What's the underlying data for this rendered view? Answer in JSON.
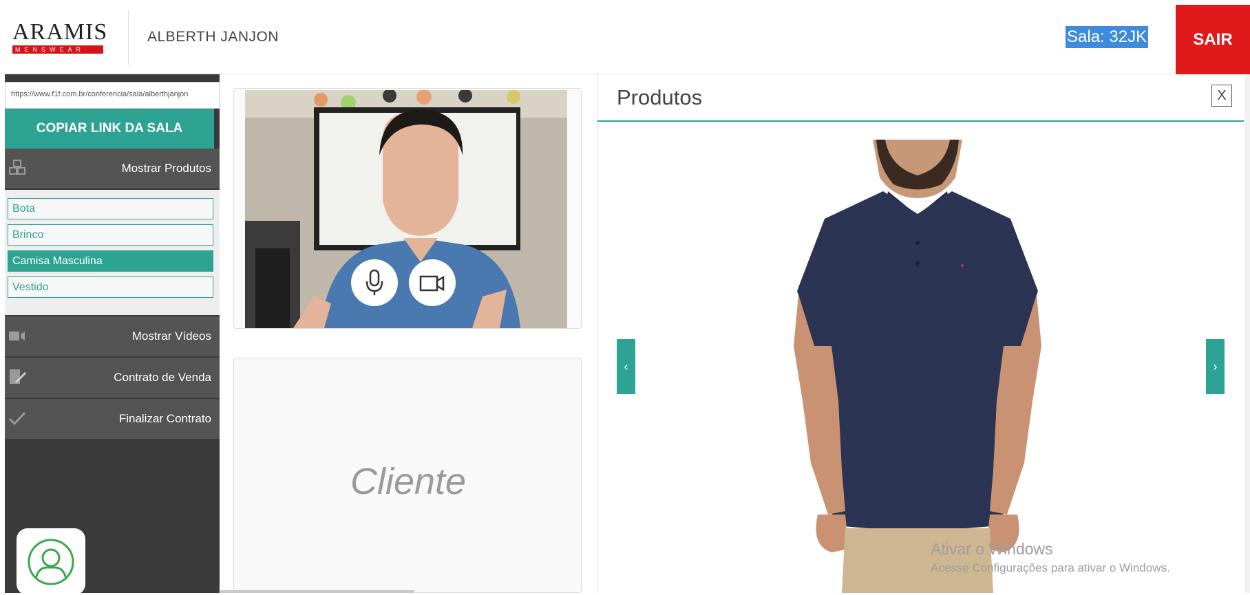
{
  "header": {
    "logo_word": "ARAMIS",
    "logo_sub": "MENSWEAR",
    "username": "ALBERTH JANJON",
    "room_label": "Sala: 32JK",
    "exit_label": "SAIR"
  },
  "sidebar": {
    "room_url": "https://www.f1f.com.br/conferencia/sala/alberthjanjon",
    "copy_link_label": "COPIAR LINK DA SALA",
    "show_products_label": "Mostrar Produtos",
    "products": [
      "Bota",
      "Brinco",
      "Camisa Masculina",
      "Vestido"
    ],
    "selected_product": "Camisa Masculina",
    "show_videos_label": "Mostrar Vídeos",
    "contract_label": "Contrato de Venda",
    "finish_label": "Finalizar Contrato"
  },
  "main": {
    "client_label": "Cliente"
  },
  "panel": {
    "title": "Produtos",
    "close_label": "X",
    "prev_label": "‹",
    "next_label": "›"
  },
  "watermark": {
    "line1": "Ativar o Windows",
    "line2": "Acesse Configurações para ativar o Windows."
  },
  "colors": {
    "accent": "#2da394",
    "exit": "#e01a1a",
    "sidebar_bg": "#3a3a3a",
    "menu_bg": "#545454",
    "shirt": "#2b3452"
  }
}
